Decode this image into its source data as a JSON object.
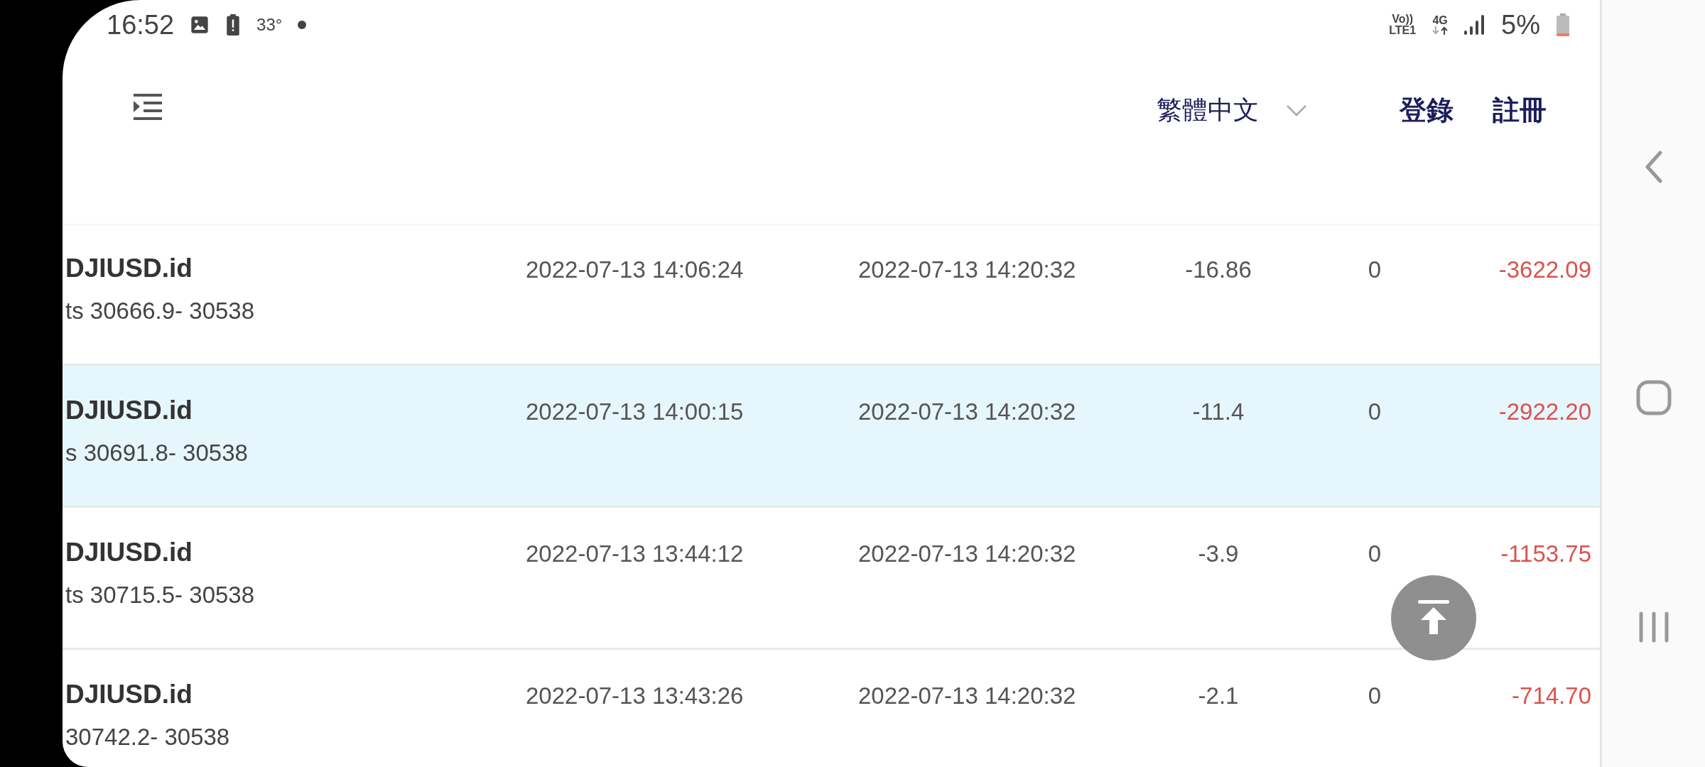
{
  "status_bar": {
    "time": "16:52",
    "temperature": "33°",
    "volte": [
      "Vo))",
      "LTE1"
    ],
    "network": "4G",
    "battery": "5%"
  },
  "header": {
    "language": "繁體中文",
    "login": "登錄",
    "register": "註冊"
  },
  "rows": [
    {
      "symbol": "DJIUSD.id",
      "detail": "ts 30666.9- 30538",
      "open_time": "2022-07-13 14:06:24",
      "close_time": "2022-07-13 14:20:32",
      "column_4": "-16.86",
      "column_5": "0",
      "profit": "-3622.09",
      "selected": false
    },
    {
      "symbol": "DJIUSD.id",
      "detail": "s 30691.8- 30538",
      "open_time": "2022-07-13 14:00:15",
      "close_time": "2022-07-13 14:20:32",
      "column_4": "-11.4",
      "column_5": "0",
      "profit": "-2922.20",
      "selected": true
    },
    {
      "symbol": "DJIUSD.id",
      "detail": "ts 30715.5- 30538",
      "open_time": "2022-07-13 13:44:12",
      "close_time": "2022-07-13 14:20:32",
      "column_4": "-3.9",
      "column_5": "0",
      "profit": "-1153.75",
      "selected": false
    },
    {
      "symbol": "DJIUSD.id",
      "detail": "30742.2- 30538",
      "open_time": "2022-07-13 13:43:26",
      "close_time": "2022-07-13 14:20:32",
      "column_4": "-2.1",
      "column_5": "0",
      "profit": "-714.70",
      "selected": false
    }
  ]
}
